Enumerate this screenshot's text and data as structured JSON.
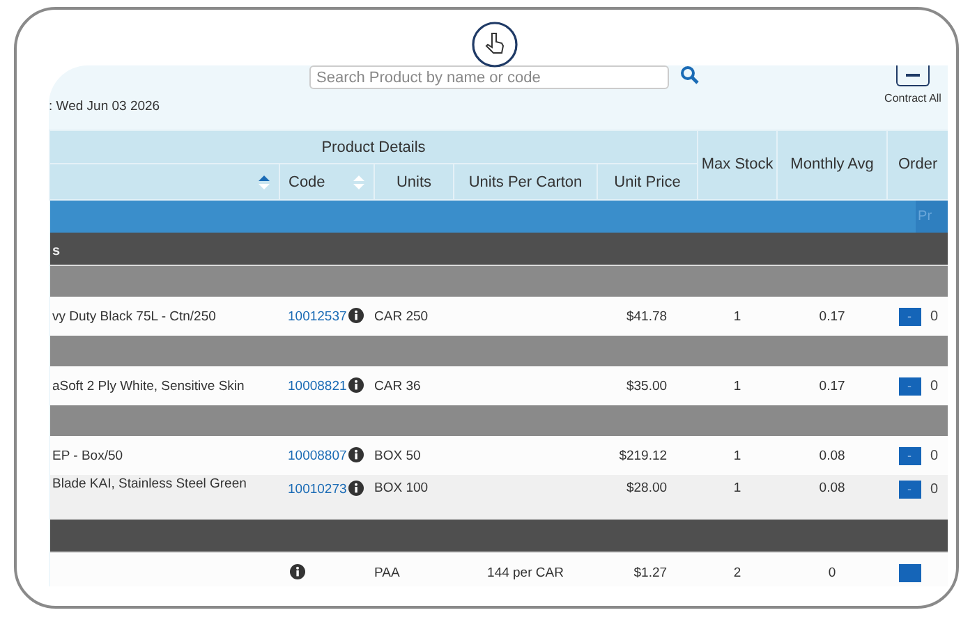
{
  "toolbar": {
    "date": ": Wed Jun 03 2026",
    "search": {
      "placeholder": "Search Product by name or code"
    },
    "contract_all": {
      "label": "Contract All"
    }
  },
  "table": {
    "group_header": "Product Details",
    "columns": [
      {
        "kind": "grouped",
        "sorted": true
      },
      {
        "kind": "grouped",
        "label": "Code",
        "sorted": false
      },
      {
        "kind": "grouped",
        "label": "Units"
      },
      {
        "kind": "grouped",
        "label": "Units Per Carton"
      },
      {
        "kind": "grouped",
        "label": "Unit Price"
      },
      {
        "kind": "standalone",
        "label": "Max Stock"
      },
      {
        "kind": "standalone",
        "label": "Monthly Avg"
      },
      {
        "kind": "standalone",
        "label": "Order"
      }
    ],
    "action_button": {
      "label": "Pr"
    },
    "rows": [
      {
        "kind": "category",
        "label": "s"
      },
      {
        "kind": "subgroup"
      },
      {
        "kind": "product",
        "shaded": false,
        "name": "vy Duty Black 75L - Ctn/250",
        "code": "10012537",
        "units": "CAR 250",
        "unit_price": "$41.78",
        "max_stock": "1",
        "monthly_avg": "0.17",
        "decrement": "-",
        "quantity": "0"
      },
      {
        "kind": "subgroup"
      },
      {
        "kind": "product",
        "shaded": false,
        "name": "aSoft 2 Ply White, Sensitive Skin",
        "code": "10008821",
        "units": "CAR 36",
        "unit_price": "$35.00",
        "max_stock": "1",
        "monthly_avg": "0.17",
        "decrement": "-",
        "quantity": "0"
      },
      {
        "kind": "subgroup"
      },
      {
        "kind": "product",
        "shaded": false,
        "name": "EP - Box/50",
        "code": "10008807",
        "units": "BOX 50",
        "unit_price": "$219.12",
        "max_stock": "1",
        "monthly_avg": "0.08",
        "decrement": "-",
        "quantity": "0"
      },
      {
        "kind": "product",
        "shaded": true,
        "name": "Blade KAI, Stainless Steel Green",
        "code": "10010273",
        "units": "BOX 100",
        "unit_price": "$28.00",
        "max_stock": "1",
        "monthly_avg": "0.08",
        "decrement": "-",
        "quantity": "0"
      },
      {
        "kind": "category"
      },
      {
        "kind": "product",
        "shaded": false,
        "units": "PAA",
        "units_per_carton": "144 per CAR",
        "unit_price": "$1.27",
        "max_stock": "2",
        "monthly_avg": "0"
      }
    ]
  }
}
